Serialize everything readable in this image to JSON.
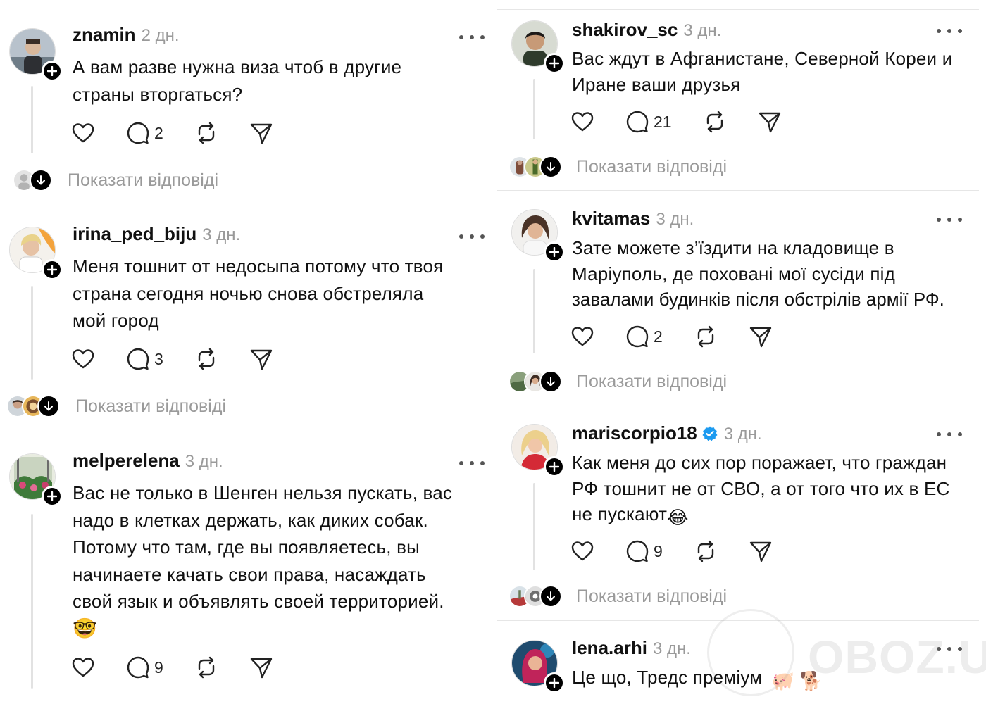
{
  "ui": {
    "show_replies_label": "Показати відповіді",
    "icons": {
      "like": "heart-icon",
      "comment": "comment-icon",
      "repost": "repost-icon",
      "share": "send-icon",
      "more": "more-dots-icon",
      "follow": "plus-icon",
      "expand": "arrow-down-icon"
    }
  },
  "left": [
    {
      "username": "znamin",
      "time": "2 дн.",
      "lines": [
        "А вам разве нужна виза чтоб в другие",
        "страны вторгаться?"
      ],
      "comments": "2",
      "replies_label": "Показати відповіді"
    },
    {
      "username": "irina_ped_biju",
      "time": "3 дн.",
      "lines": [
        "Меня тошнит от недосыпа потому что твоя",
        "страна сегодня ночью снова обстреляла",
        "мой город"
      ],
      "comments": "3",
      "replies_label": "Показати відповіді"
    },
    {
      "username": "melperelena",
      "time": "3 дн.",
      "lines": [
        "Вас не только в Шенген нельзя пускать, вас",
        "надо в клетках держать, как диких собак.",
        "Потому что там, где вы появляетесь, вы",
        "начинаете качать свои права, насаждать",
        "свой язык и объявлять своей территорией."
      ],
      "emoji_line": "🤓",
      "comments": "9"
    }
  ],
  "right": [
    {
      "username": "shakirov_sc",
      "time": "3 дн.",
      "lines": [
        "Вас ждут в Афганистане, Северной Кореи и",
        "Иране ваши друзья"
      ],
      "comments": "21",
      "replies_label": "Показати відповіді"
    },
    {
      "username": "kvitamas",
      "time": "3 дн.",
      "lines": [
        "Зате можете з’їздити на кладовище в",
        "Маріуполь, де поховані мої сусіди під",
        "завалами будинків після обстрілів армії РФ."
      ],
      "comments": "2",
      "replies_label": "Показати відповіді"
    },
    {
      "username": "mariscorpio18",
      "time": "3 дн.",
      "verified": true,
      "lines": [
        "Как меня до сих пор поражает, что граждан",
        "РФ тошнит не от СВО, а от того что их в ЕС"
      ],
      "last_line_text": "не пускают",
      "last_line_emoji": "😂",
      "comments": "9",
      "replies_label": "Показати відповіді"
    },
    {
      "username": "lena.arhi",
      "time": "3 дн.",
      "text": "Це що, Тредс преміум",
      "emojis": "🐖 🐕"
    }
  ],
  "watermark": {
    "text": "OBOZ.UA"
  },
  "colors": {
    "text": "#111111",
    "muted": "#9a9a9a",
    "divider": "#e6e6e6",
    "verified": "#1d9bf0",
    "badge": "#000000"
  }
}
